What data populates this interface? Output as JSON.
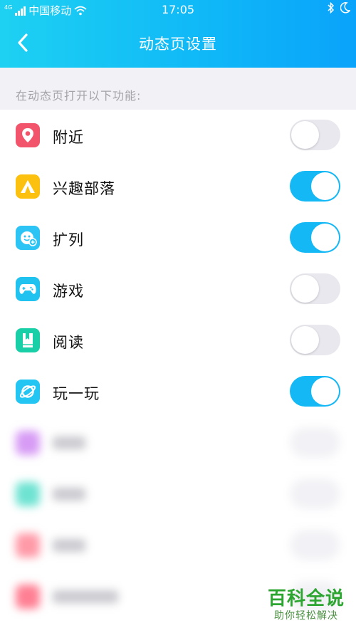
{
  "status_bar": {
    "network_tag": "4G",
    "carrier": "中国移动",
    "time": "17:05",
    "icons": [
      "signal-icon",
      "wifi-icon",
      "bluetooth-icon",
      "moon-icon"
    ]
  },
  "nav": {
    "title": "动态页设置",
    "back_icon": "chevron-left-icon"
  },
  "section_header": "在动态页打开以下功能:",
  "features": [
    {
      "label": "附近",
      "icon": "location-pin-icon",
      "color": "#f2556b",
      "enabled": false
    },
    {
      "label": "兴趣部落",
      "icon": "tent-icon",
      "color": "#fcc00e",
      "enabled": true
    },
    {
      "label": "扩列",
      "icon": "smiley-plus-icon",
      "color": "#2bc4f4",
      "enabled": true
    },
    {
      "label": "游戏",
      "icon": "gamepad-icon",
      "color": "#20c2ef",
      "enabled": false
    },
    {
      "label": "阅读",
      "icon": "book-icon",
      "color": "#18cfa8",
      "enabled": false
    },
    {
      "label": "玩一玩",
      "icon": "planet-icon",
      "color": "#23c5f3",
      "enabled": true
    }
  ],
  "blurred_icon_colors": [
    "#d79bf5",
    "#6fe3d2",
    "#ff9aa8",
    "#ff7f93"
  ],
  "colors": {
    "accent": "#14b8f4",
    "header_gradient_start": "#1ed1f2",
    "header_gradient_end": "#0aa3fb"
  },
  "watermark": {
    "title": "百科全说",
    "subtitle": "助你轻松解决"
  }
}
